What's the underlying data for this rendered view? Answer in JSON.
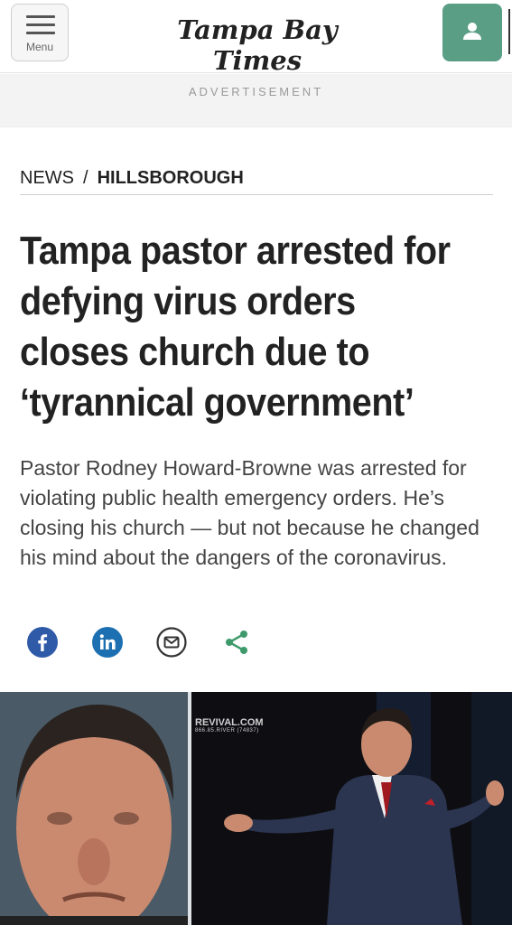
{
  "header": {
    "menu_label": "Menu",
    "logo_text": "Tampa Bay Times",
    "accent_color": "#5a9e85"
  },
  "ad": {
    "label": "ADVERTISEMENT"
  },
  "breadcrumb": {
    "section": "NEWS",
    "separator": "/",
    "subsection": "HILLSBOROUGH"
  },
  "article": {
    "headline": "Tampa pastor arrested for defying virus orders closes church due to ‘tyrannical government’",
    "dek": "Pastor Rodney Howard-Browne was arrested for violating public health emergency orders. He’s closing his church — but not because he changed his mind about the dangers of the coronavirus."
  },
  "share": {
    "icons": [
      "facebook-icon",
      "linkedin-icon",
      "email-icon",
      "share-icon"
    ]
  },
  "photo": {
    "overlay_brand": "REVIVAL.COM",
    "overlay_phone": "866.85.RIVER (74837)"
  }
}
